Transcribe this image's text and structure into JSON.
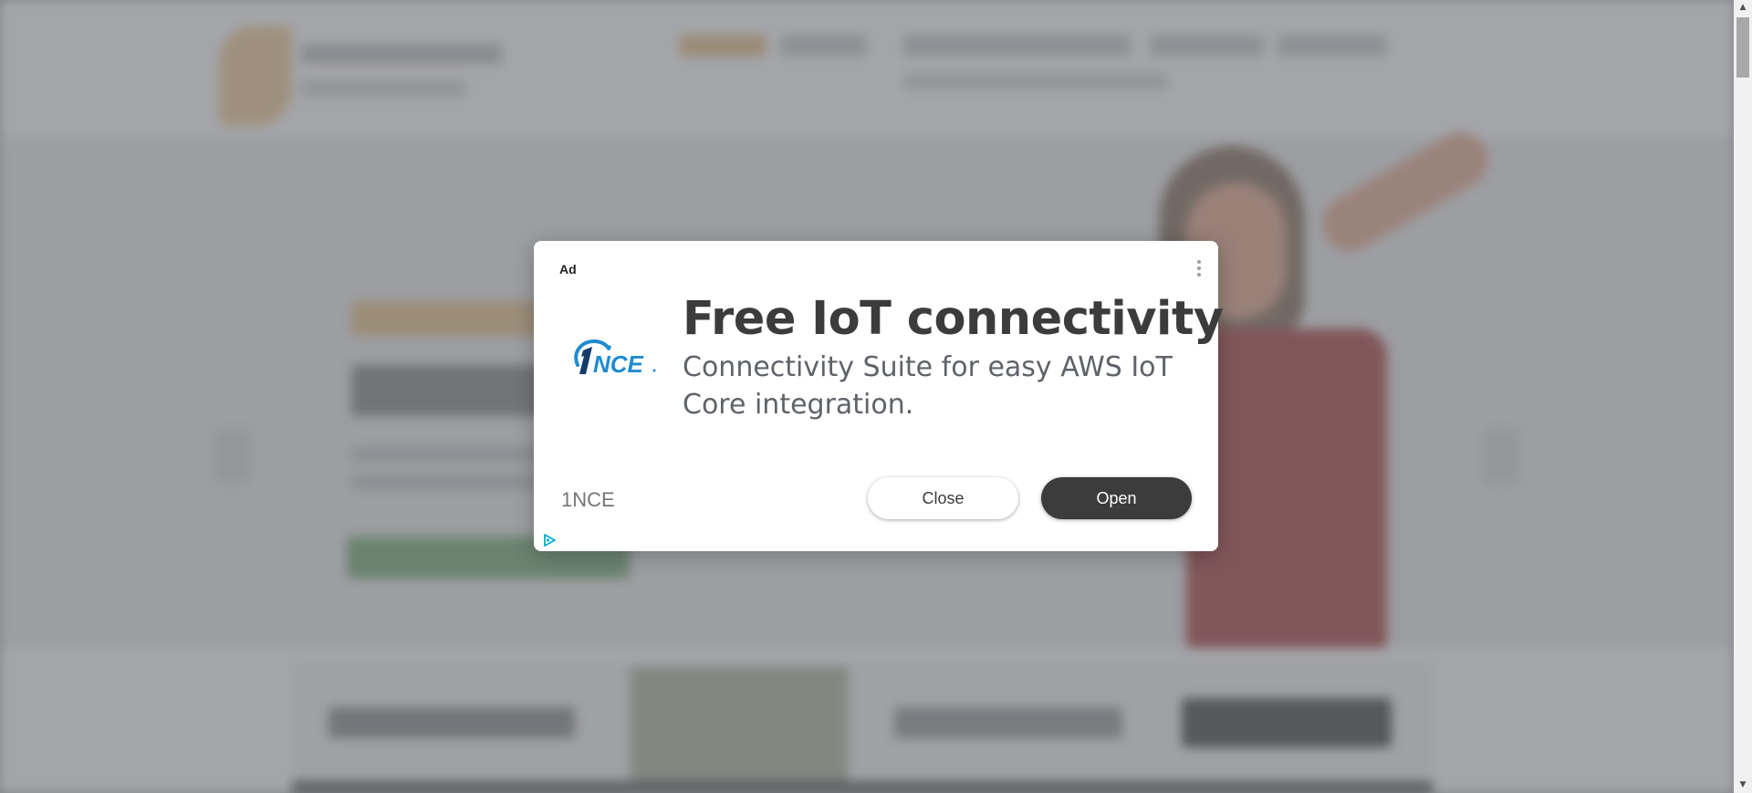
{
  "ad": {
    "label": "Ad",
    "headline": "Free IoT connectivity",
    "description": "Connectivity Suite for easy AWS IoT Core integration.",
    "advertiser": "1NCE",
    "logo_text": "1NCE",
    "close_label": "Close",
    "open_label": "Open"
  },
  "icons": {
    "menu": "more-vert-icon",
    "adchoices": "adchoices-icon",
    "scroll_up": "scroll-up-arrow-icon",
    "scroll_down": "scroll-down-arrow-icon"
  },
  "colors": {
    "logo_blue": "#1f8bd0",
    "logo_navy": "#143b6b",
    "open_button": "#3c3c3c",
    "adchoices": "#00aecd"
  }
}
